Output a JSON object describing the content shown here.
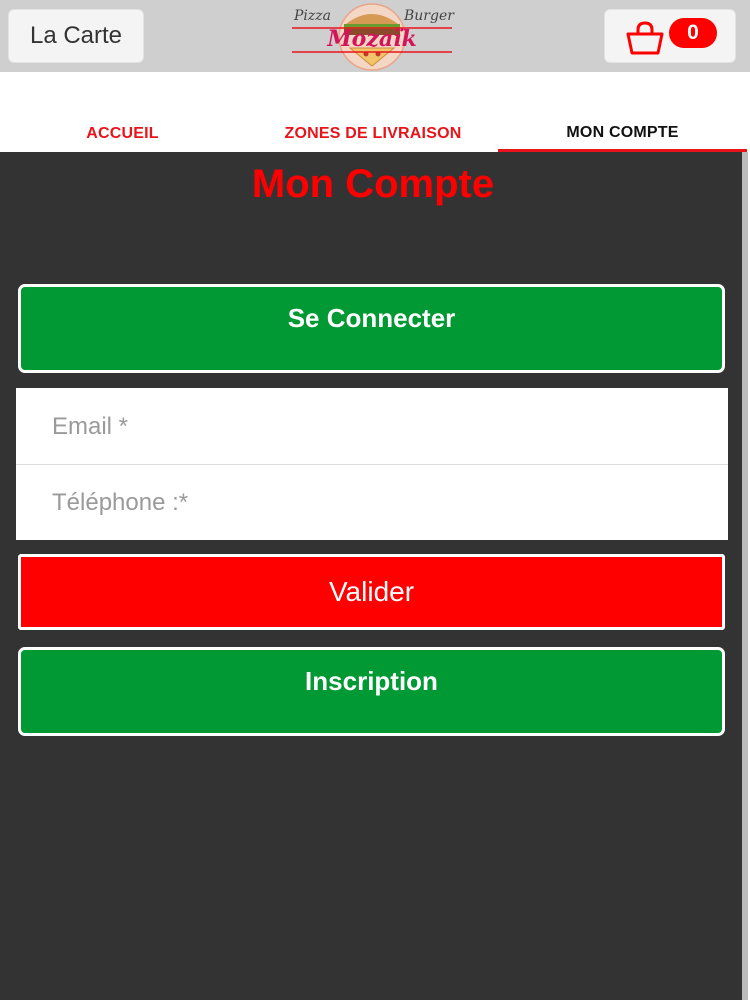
{
  "header": {
    "menu_button_label": "La Carte",
    "logo": {
      "top_left_text": "Pizza",
      "top_right_text": "Burger",
      "brand_text": "Mozaïk"
    },
    "cart": {
      "icon": "shopping-bag-icon",
      "count": "0"
    }
  },
  "tabs": [
    {
      "label": "ACCUEIL",
      "active": false
    },
    {
      "label": "ZONES DE LIVRAISON",
      "active": false
    },
    {
      "label": "MON COMPTE",
      "active": true
    }
  ],
  "main": {
    "title": "Mon Compte",
    "login_button_label": "Se Connecter",
    "email_placeholder": "Email *",
    "phone_placeholder": "Téléphone :*",
    "submit_button_label": "Valider",
    "signup_button_label": "Inscription"
  },
  "colors": {
    "accent_red": "#ff0000",
    "button_green": "#009933",
    "panel_background": "#333333",
    "header_background": "#cfcfcf"
  }
}
